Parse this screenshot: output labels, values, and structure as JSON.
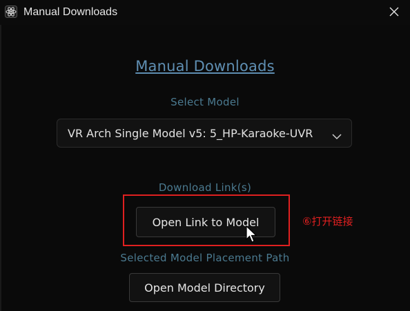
{
  "window": {
    "title": "Manual Downloads"
  },
  "main": {
    "heading": "Manual Downloads",
    "select_model_label": "Select Model",
    "selected_model": "VR Arch Single Model v5: 5_HP-Karaoke-UVR",
    "download_links_label": "Download Link(s)",
    "open_link_button": "Open Link to Model",
    "placement_path_label": "Selected Model Placement Path",
    "open_directory_button": "Open Model Directory"
  },
  "annotation": {
    "text": "⑥打开链接"
  },
  "colors": {
    "background": "#0a0a0a",
    "link_blue": "#5f8fb3",
    "label_teal": "#4b7a90",
    "annotation_red": "#e02020"
  },
  "icons": {
    "app": "atom-icon",
    "close": "close-icon",
    "dropdown": "chevron-down-icon",
    "cursor": "mouse-pointer-icon"
  }
}
